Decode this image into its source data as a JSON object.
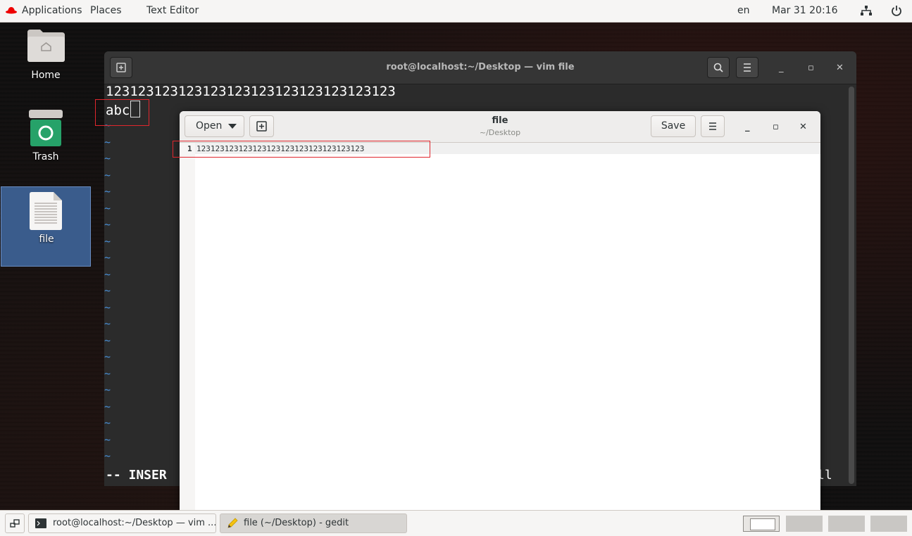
{
  "topbar": {
    "applications": "Applications",
    "places": "Places",
    "active_app": "Text Editor",
    "language": "en",
    "datetime": "Mar 31  20:16"
  },
  "desktop": {
    "icons": [
      {
        "label": "Home"
      },
      {
        "label": "Trash"
      },
      {
        "label": "file"
      }
    ]
  },
  "terminal": {
    "title": "root@localhost:~/Desktop — vim file",
    "line1": "123123123123123123123123123123123123",
    "line2": "abc",
    "mode": "-- INSER",
    "status_right": "ll",
    "tilde": "~"
  },
  "gedit": {
    "open_label": "Open",
    "title": "file",
    "subtitle": "~/Desktop",
    "save_label": "Save",
    "line_number": "1",
    "content": "123123123123123123123123123123123123"
  },
  "taskbar": {
    "tasks": [
      {
        "label": "root@localhost:~/Desktop — vim ..."
      },
      {
        "label": "file (~/Desktop) - gedit"
      }
    ]
  },
  "colors": {
    "annotation": "#e0262d",
    "selection": "#3a5c8c",
    "vim_tilde": "#4a90d9"
  }
}
